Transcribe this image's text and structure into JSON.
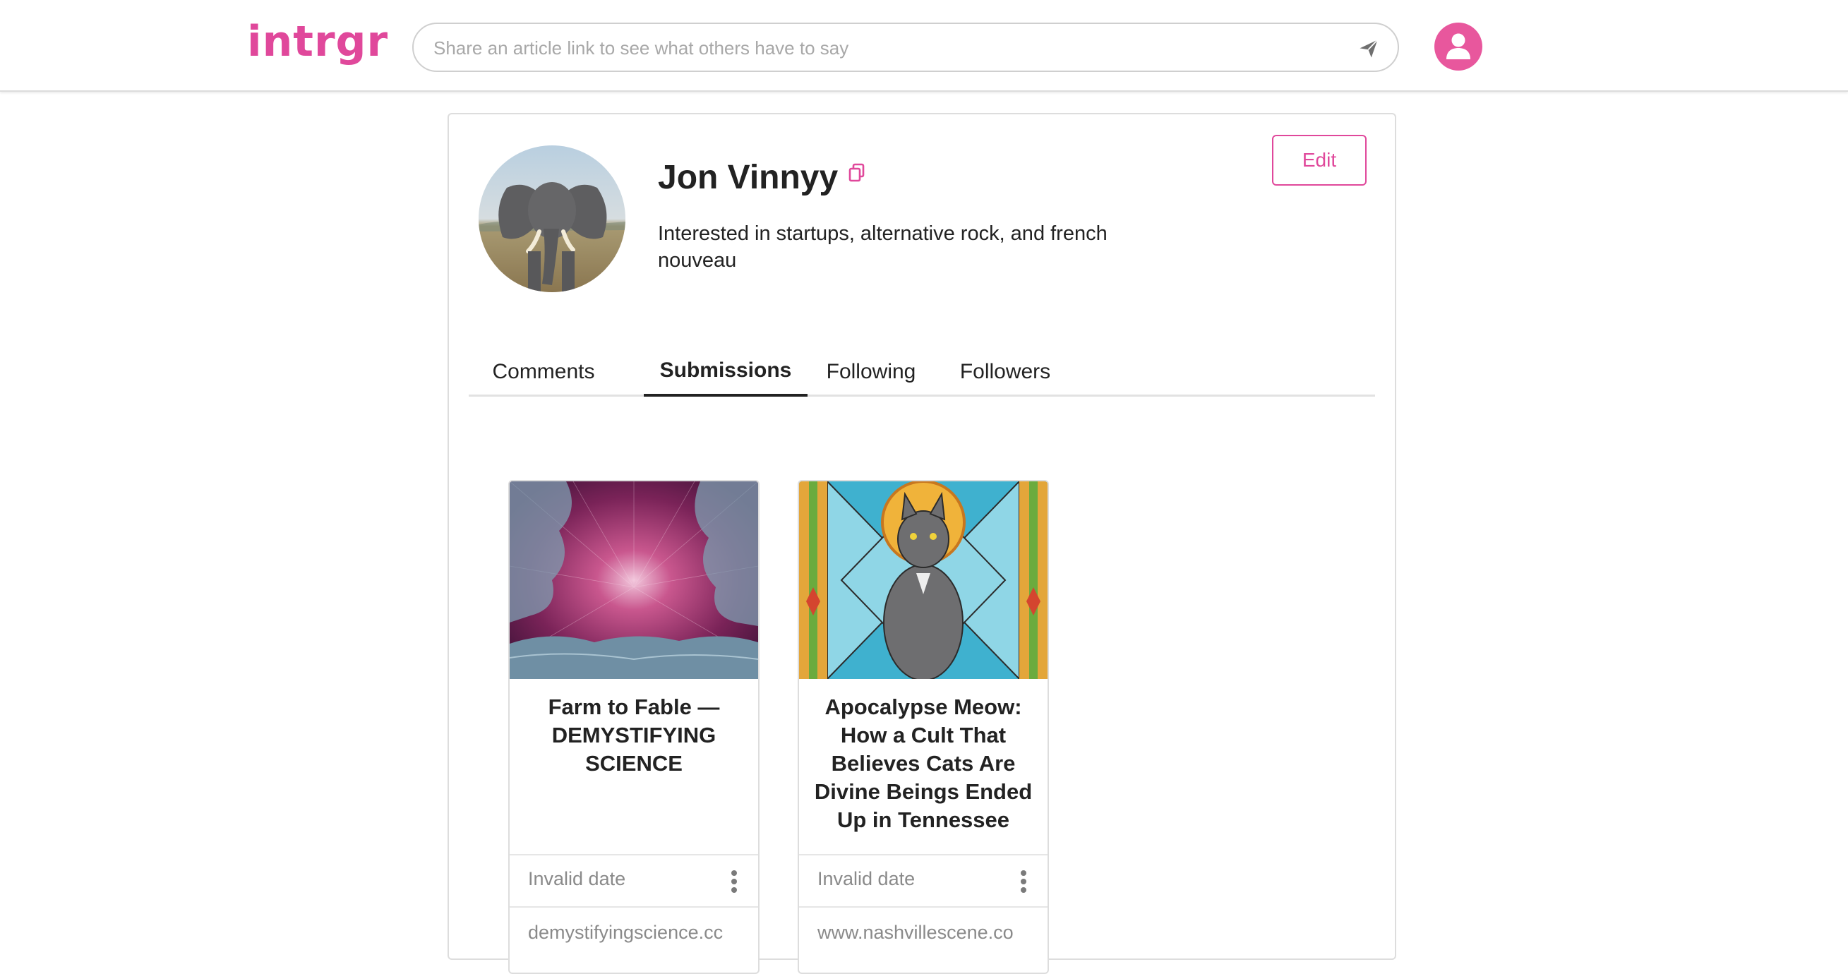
{
  "header": {
    "logo": "intrgr",
    "search_placeholder": "Share an article link to see what others have to say",
    "search_value": "",
    "send_icon": "send-icon",
    "account_icon": "user-icon",
    "brand_color": "#e0489b"
  },
  "profile": {
    "name": "Jon Vinnyy",
    "bio": "Interested in startups, alternative rock, and french nouveau",
    "edit_label": "Edit",
    "copy_icon": "copy-icon"
  },
  "tabs": [
    {
      "label": "Comments",
      "active": false
    },
    {
      "label": "Submissions",
      "active": true
    },
    {
      "label": "Following",
      "active": false
    },
    {
      "label": "Followers",
      "active": false
    }
  ],
  "submissions": [
    {
      "title": "Farm to Fable — DEMYSTIFYING SCIENCE",
      "date": "Invalid date",
      "domain": "demystifyingscience.cc",
      "menu_icon": "more-vertical-icon"
    },
    {
      "title": "Apocalypse Meow: How a Cult That Believes Cats Are Divine Beings Ended Up in Tennessee",
      "date": "Invalid date",
      "domain": "www.nashvillescene.co",
      "menu_icon": "more-vertical-icon"
    }
  ]
}
